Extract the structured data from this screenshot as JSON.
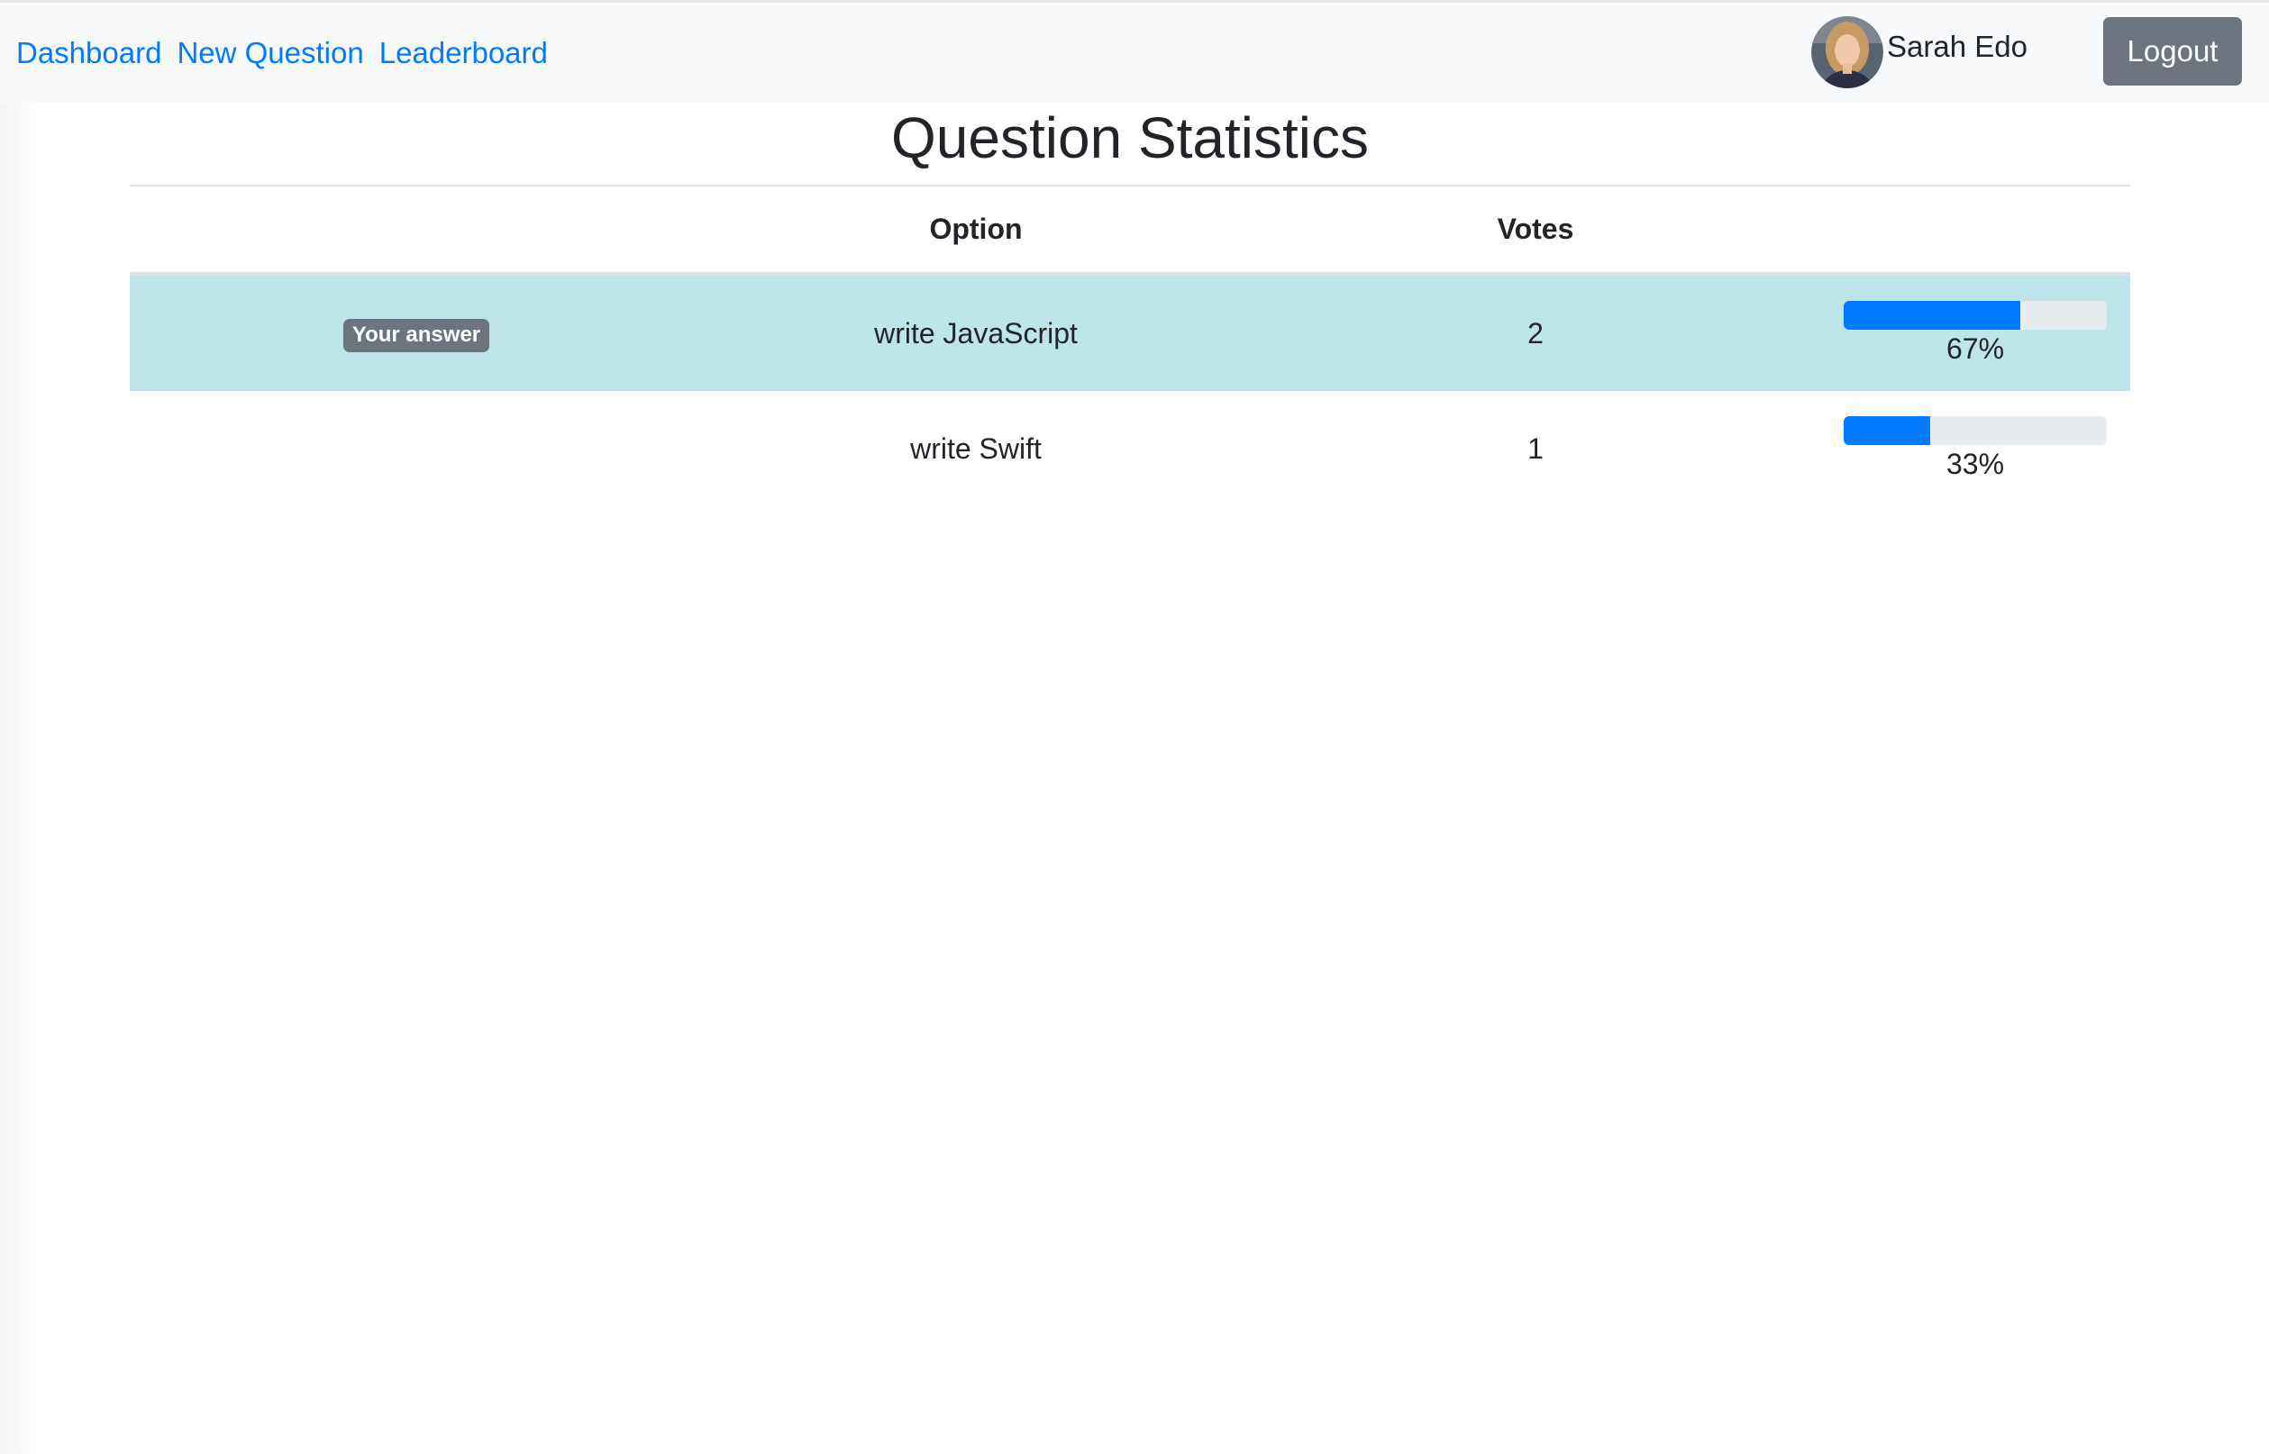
{
  "nav": {
    "links": [
      {
        "label": "Dashboard"
      },
      {
        "label": "New Question"
      },
      {
        "label": "Leaderboard"
      }
    ]
  },
  "user": {
    "name": "Sarah Edo",
    "logout_label": "Logout"
  },
  "page": {
    "title": "Question Statistics"
  },
  "table": {
    "headers": {
      "badge": "",
      "option": "Option",
      "votes": "Votes",
      "progress": ""
    },
    "rows": [
      {
        "badge": "Your answer",
        "option": "write JavaScript",
        "votes": "2",
        "percent_label": "67%",
        "percent": 67,
        "selected": true
      },
      {
        "badge": "",
        "option": "write Swift",
        "votes": "1",
        "percent_label": "33%",
        "percent": 33,
        "selected": false
      }
    ]
  },
  "colors": {
    "link": "#007bff",
    "progress_fill": "#007bff",
    "progress_track": "#e9ecef",
    "selected_row": "#bee5eb",
    "badge": "#6c757d",
    "logout_button": "#6c757d",
    "navbar": "#f8f9fa"
  }
}
